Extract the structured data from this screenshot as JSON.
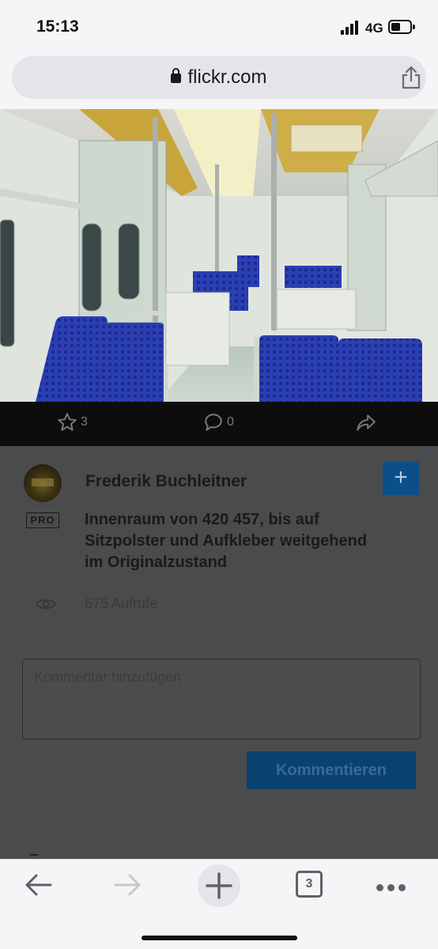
{
  "status": {
    "time": "15:13",
    "network": "4G"
  },
  "browser": {
    "url": "flickr.com",
    "tab_count": "3"
  },
  "photo": {
    "stars": "3",
    "comments": "0"
  },
  "details": {
    "author": "Frederik Buchleitner",
    "badge": "PRO",
    "follow_symbol": "+",
    "title": "Innenraum von 420 457, bis auf Sitzpolster und Aufkleber weitgehend im Originalzustand",
    "views": "675 Aufrufe",
    "comment_placeholder": "Kommentar hinzufügen",
    "comment_button": "Kommentieren"
  },
  "colors": {
    "accent": "#0a4f8a",
    "overlay": "#4a4b4d",
    "seat_blue": "#2a3fb8"
  },
  "icons": [
    "lock-icon",
    "share-icon",
    "star-icon",
    "comment-icon",
    "share-arrow-icon",
    "eye-icon",
    "back-icon",
    "forward-icon",
    "new-tab-icon",
    "tabs-icon",
    "more-icon"
  ]
}
